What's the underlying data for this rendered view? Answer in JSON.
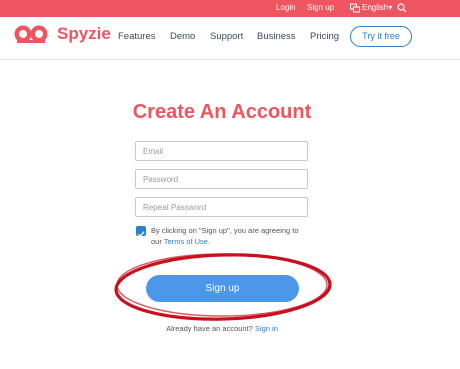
{
  "topbar": {
    "login": "Login",
    "signup": "Sign up",
    "language": "English"
  },
  "nav": {
    "brand": "Spyzie",
    "items": [
      "Features",
      "Demo",
      "Support",
      "Business",
      "Pricing"
    ],
    "try_label": "Try it free"
  },
  "form": {
    "title": "Create An Account",
    "email_placeholder": "Email",
    "password_placeholder": "Password",
    "repeat_placeholder": "Repeat Password",
    "agree_text": "By clicking on \"Sign up\", you are agreeing to our ",
    "terms_link": "Terms of Use",
    "terms_after": ".",
    "checked": true,
    "signup_label": "Sign up",
    "already_text": "Already have an account? ",
    "signin_link": "Sign in"
  },
  "colors": {
    "brand_red": "#ef5560",
    "link_blue": "#2c7fd1",
    "button_blue": "#4d97eb",
    "annotation_red": "#c8101e"
  }
}
